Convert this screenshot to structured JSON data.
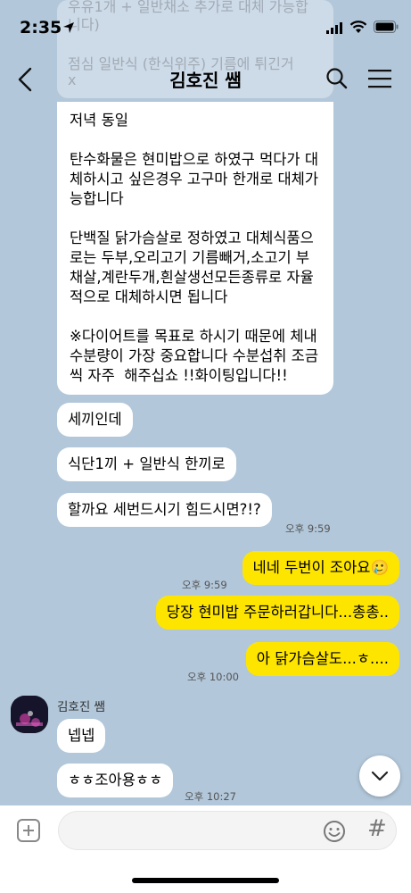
{
  "status_bar": {
    "time": "2:35"
  },
  "header": {
    "title": "김호진 쌤"
  },
  "faded_message": {
    "line1": "우유1개 + 일반채소 추가로 대체 가능합",
    "line2": "니다)",
    "line3": "점심 일반식 (한식위주) 기름에 튀긴거",
    "line4": "x"
  },
  "messages": {
    "big": {
      "p1": "저녁 동일",
      "p2": "탄수화물은 현미밥으로 하였구 먹다가 대체하시고 싶은경우 고구마 한개로 대체가능합니다",
      "p3": "단백질 닭가슴살로 정하였고 대체식품으로는 두부,오리고기 기름빼거,소고기 부채살,계란두개,흰살생선모든종류로 자율적으로 대체하시면 됩니다",
      "p4": "※다이어트를 목표로 하시기 때문에 체내 수분량이 가장 중요합니다 수분섭취 조금씩 자주  해주십쇼 !!화이팅입니다!!"
    },
    "m1": "세끼인데",
    "m2": "식단1끼 + 일반식 한끼로",
    "m3": "할까요 세번드시기 힘드시면?!?",
    "t1": "오후 9:59",
    "y1": "네네 두번이 조아요🥲",
    "t2": "오후 9:59",
    "y2": "당장 현미밥 주문하러갑니다...총총..",
    "y3": "아 닭가슴살도...ㅎ....",
    "t3": "오후 10:00",
    "sender": "김호진 쌤",
    "r1": "넵넵",
    "r2": "ㅎㅎ조아용ㅎㅎ",
    "t4": "오후 10:27"
  },
  "input": {
    "placeholder": ""
  }
}
